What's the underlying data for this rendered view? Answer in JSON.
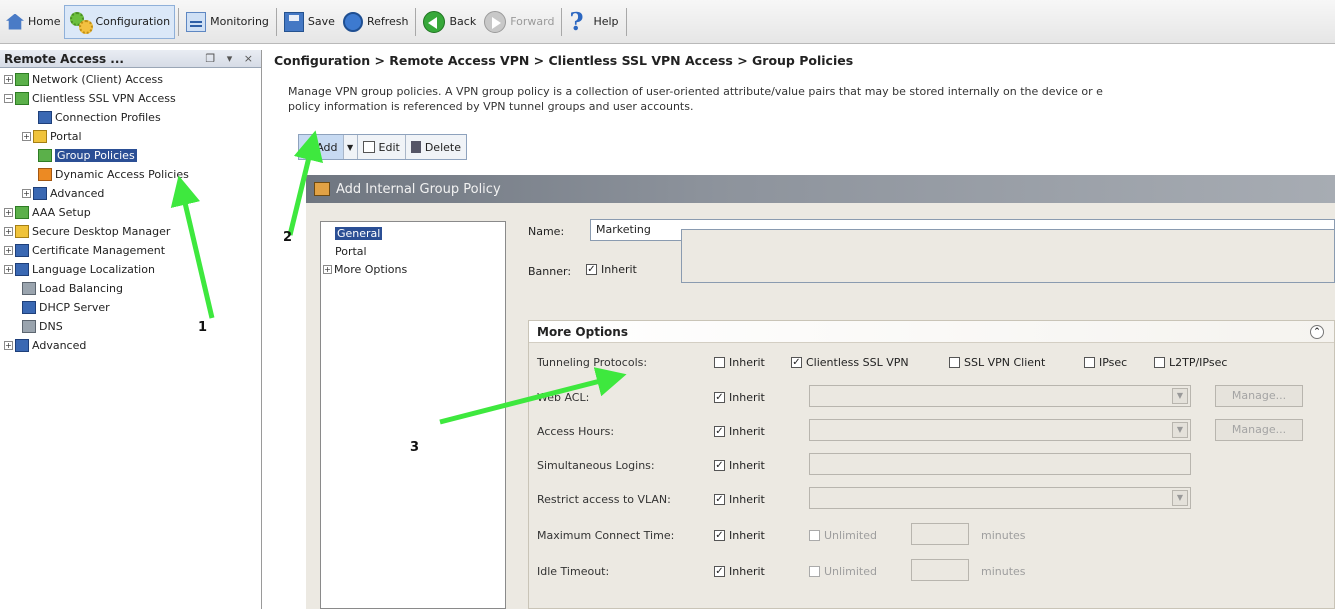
{
  "toolbar": {
    "home": "Home",
    "configuration": "Configuration",
    "monitoring": "Monitoring",
    "save": "Save",
    "refresh": "Refresh",
    "back": "Back",
    "forward": "Forward",
    "help": "Help"
  },
  "nav": {
    "title": "Remote Access ...",
    "controls": "❐ ▾ ×",
    "items": [
      {
        "label": "Network (Client) Access"
      },
      {
        "label": "Clientless SSL VPN Access"
      },
      {
        "label": "Connection Profiles"
      },
      {
        "label": "Portal"
      },
      {
        "label": "Group Policies"
      },
      {
        "label": "Dynamic Access Policies"
      },
      {
        "label": "Advanced"
      },
      {
        "label": "AAA Setup"
      },
      {
        "label": "Secure Desktop Manager"
      },
      {
        "label": "Certificate Management"
      },
      {
        "label": "Language Localization"
      },
      {
        "label": "Load Balancing"
      },
      {
        "label": "DHCP Server"
      },
      {
        "label": "DNS"
      },
      {
        "label": "Advanced"
      }
    ]
  },
  "main": {
    "breadcrumb": "Configuration > Remote Access VPN > Clientless SSL VPN Access > Group Policies",
    "description_line1": "Manage VPN group policies. A VPN group policy is a collection of user-oriented attribute/value pairs that may be stored internally on the device or e",
    "description_line2": "policy information is referenced by VPN tunnel groups and user accounts.",
    "actions": {
      "add": "Add",
      "edit": "Edit",
      "delete": "Delete"
    }
  },
  "dialog": {
    "title": "Add Internal Group Policy",
    "tree": [
      "General",
      "Portal",
      "More Options"
    ],
    "name_label": "Name:",
    "name_value": "Marketing",
    "banner_label": "Banner:",
    "inherit": "Inherit",
    "more_options": {
      "title": "More Options",
      "tunneling_label": "Tunneling Protocols:",
      "tunneling_options": [
        "Inherit",
        "Clientless SSL VPN",
        "SSL VPN Client",
        "IPsec",
        "L2TP/IPsec"
      ],
      "web_acl_label": "Web ACL:",
      "access_hours_label": "Access Hours:",
      "simultaneous_label": "Simultaneous Logins:",
      "vlan_label": "Restrict access to VLAN:",
      "max_connect_label": "Maximum Connect Time:",
      "idle_label": "Idle Timeout:",
      "manage": "Manage...",
      "unlimited": "Unlimited",
      "minutes": "minutes"
    }
  },
  "annotations": {
    "one": "1",
    "two": "2",
    "three": "3"
  },
  "colors": {
    "arrow": "#3ee83e",
    "selection": "#2b4f95"
  }
}
